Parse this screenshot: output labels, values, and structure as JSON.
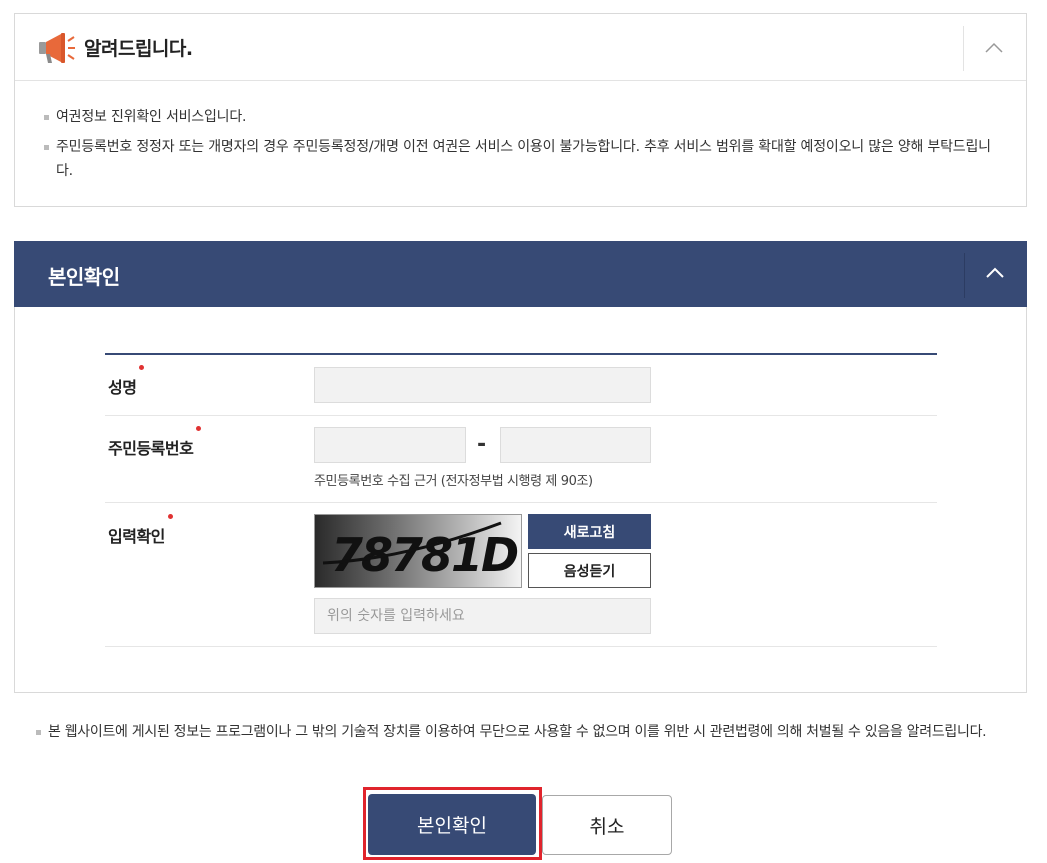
{
  "notice": {
    "title": "알려드립니다.",
    "items": [
      "여권정보 진위확인 서비스입니다.",
      "주민등록번호 정정자 또는 개명자의 경우 주민등록정정/개명 이전 여권은 서비스 이용이 불가능합니다. 추후 서비스 범위를 확대할 예정이오니 많은 양해 부탁드립니다."
    ],
    "toggle_icon": "chevron-up-icon"
  },
  "identity": {
    "title": "본인확인",
    "toggle_icon": "chevron-up-icon",
    "name_label": "성명",
    "name_value": "",
    "rrn_label": "주민등록번호",
    "rrn_front_value": "",
    "rrn_back_value": "",
    "rrn_separator": "-",
    "rrn_hint": "주민등록번호 수집 근거 (전자정부법 시행령 제 90조)",
    "captcha_label": "입력확인",
    "captcha_text": "78781D",
    "refresh_label": "새로고침",
    "audio_label": "음성듣기",
    "captcha_placeholder": "위의 숫자를 입력하세요"
  },
  "legal_notice": "본 웹사이트에 게시된 정보는 프로그램이나 그 밖의 기술적 장치를 이용하여 무단으로 사용할 수 없으며 이를 위반 시 관련법령에 의해 처벌될 수 있음을 알려드립니다.",
  "actions": {
    "confirm_label": "본인확인",
    "cancel_label": "취소"
  },
  "colors": {
    "primary": "#374a75",
    "required_dot": "#e03232",
    "highlight_border": "#e0242c"
  }
}
